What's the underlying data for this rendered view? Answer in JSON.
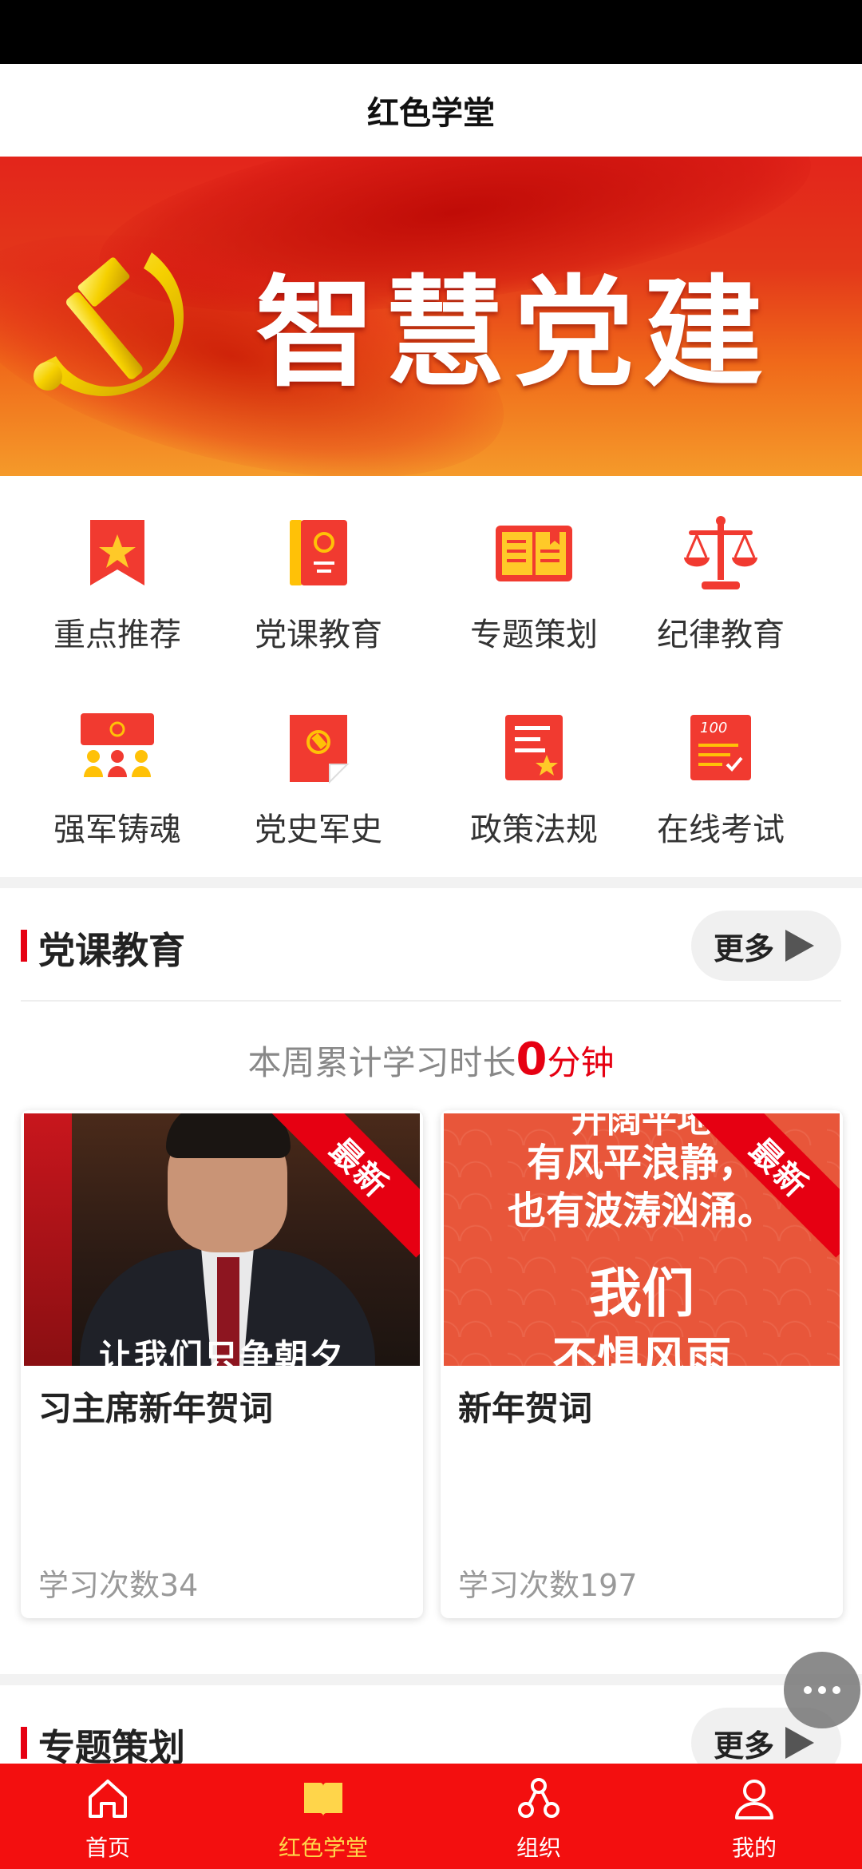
{
  "header": {
    "title": "红色学堂"
  },
  "banner": {
    "text": "智慧党建"
  },
  "grid": {
    "items": [
      {
        "label": "重点推荐",
        "icon": "star-bookmark-icon"
      },
      {
        "label": "党课教育",
        "icon": "party-book-icon"
      },
      {
        "label": "专题策划",
        "icon": "open-book-icon"
      },
      {
        "label": "纪律教育",
        "icon": "scales-icon"
      },
      {
        "label": "强军铸魂",
        "icon": "meeting-icon"
      },
      {
        "label": "党史军史",
        "icon": "party-document-icon"
      },
      {
        "label": "政策法规",
        "icon": "policy-document-icon"
      },
      {
        "label": "在线考试",
        "icon": "exam-icon"
      }
    ]
  },
  "section1": {
    "title": "党课教育",
    "more_label": "更多",
    "study_prefix": "本周累计学习时长",
    "study_value": "0",
    "study_unit": "分钟",
    "cards": [
      {
        "title": "习主席新年贺词",
        "count": "学习次数34",
        "badge": "最新",
        "thumb_caption": "让我们只争朝夕"
      },
      {
        "title": "新年贺词",
        "count": "学习次数197",
        "badge": "最新",
        "thumb_lines": [
          "开阔平地",
          "有风平浪静，",
          "也有波涛汹涌。",
          "我们",
          "不惧风雨"
        ]
      }
    ]
  },
  "section2": {
    "title": "专题策划",
    "more_label": "更多"
  },
  "tabbar": {
    "tabs": [
      {
        "label": "首页",
        "icon": "home-icon"
      },
      {
        "label": "红色学堂",
        "icon": "book-icon",
        "active": true
      },
      {
        "label": "组织",
        "icon": "organization-icon"
      },
      {
        "label": "我的",
        "icon": "user-icon"
      }
    ]
  },
  "colors": {
    "primary": "#e60012",
    "tabbar": "#f30f0f",
    "active_tab": "#ffd54a",
    "icon_yellow": "#ffc107"
  }
}
